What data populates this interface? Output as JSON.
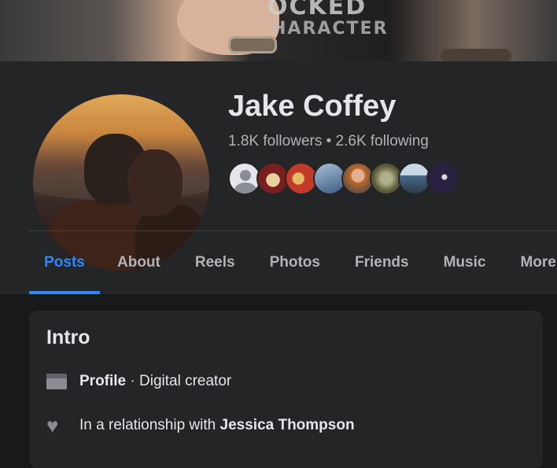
{
  "cover": {
    "text_line1": "OCKED",
    "text_line2": "HARACTER"
  },
  "profile": {
    "name": "Jake Coffey",
    "stats": "1.8K followers • 2.6K following"
  },
  "friend_avatars": [
    "#e4e6eb",
    "#7a1f1f",
    "#c23a2a",
    "#5a7aa0",
    "#b07a5a",
    "#8a8a60",
    "#6a86a8",
    "#2a2040"
  ],
  "tabs": [
    {
      "label": "Posts",
      "active": true
    },
    {
      "label": "About"
    },
    {
      "label": "Reels"
    },
    {
      "label": "Photos"
    },
    {
      "label": "Friends"
    },
    {
      "label": "Music"
    },
    {
      "label": "More"
    }
  ],
  "intro": {
    "title": "Intro",
    "profile_label": "Profile",
    "profile_value": " · Digital creator",
    "relationship_prefix": "In a relationship with ",
    "relationship_name": "Jessica Thompson"
  },
  "colors": {
    "accent": "#2d88ff",
    "bg": "#18191a",
    "card": "#242526"
  }
}
